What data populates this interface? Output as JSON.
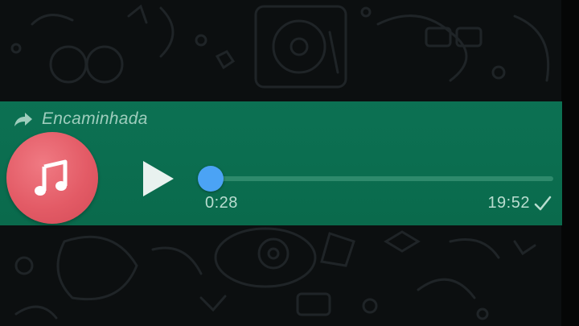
{
  "message": {
    "forwarded_label": "Encaminhada",
    "avatar_icon": "music-note-icon",
    "play_icon": "play-icon",
    "duration": "0:28",
    "timestamp": "19:52",
    "status_icon": "check-icon",
    "progress": 0.0
  },
  "colors": {
    "bubble": "#0b6e4f",
    "avatar": "#e35b66",
    "knob": "#4ba3f5",
    "background": "#0c0f10"
  }
}
